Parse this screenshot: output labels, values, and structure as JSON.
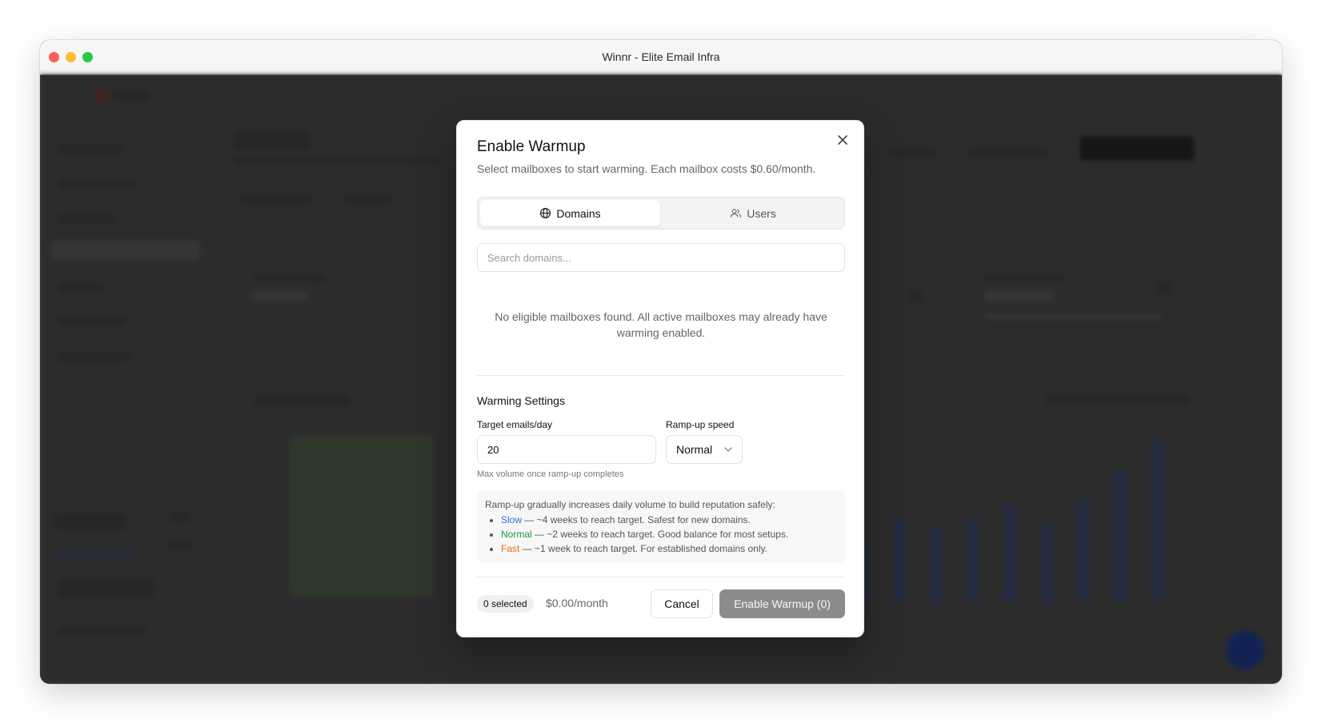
{
  "window": {
    "title": "Winnr - Elite Email Infra"
  },
  "modal": {
    "title": "Enable Warmup",
    "description": "Select mailboxes to start warming. Each mailbox costs $0.60/month.",
    "tabs": [
      {
        "label": "Domains",
        "icon": "globe-icon",
        "active": true
      },
      {
        "label": "Users",
        "icon": "users-icon",
        "active": false
      }
    ],
    "search_placeholder": "Search domains...",
    "empty_message": "No eligible mailboxes found. All active mailboxes may already have warming enabled.",
    "settings": {
      "title": "Warming Settings",
      "target_label": "Target emails/day",
      "target_value": "20",
      "target_hint": "Max volume once ramp-up completes",
      "speed_label": "Ramp-up speed",
      "speed_value": "Normal"
    },
    "info": {
      "intro": "Ramp-up gradually increases daily volume to build reputation safely:",
      "items": [
        {
          "name": "Slow",
          "text": " — ~4 weeks to reach target. Safest for new domains.",
          "color": "#2b6fd6"
        },
        {
          "name": "Normal",
          "text": " — ~2 weeks to reach target. Good balance for most setups.",
          "color": "#1a9a3a"
        },
        {
          "name": "Fast",
          "text": " — ~1 week to reach target. For established domains only.",
          "color": "#e0701a"
        }
      ]
    },
    "footer": {
      "selected_badge": "0 selected",
      "price": "$0.00/month",
      "cancel_label": "Cancel",
      "enable_label": "Enable Warmup (0)"
    }
  }
}
